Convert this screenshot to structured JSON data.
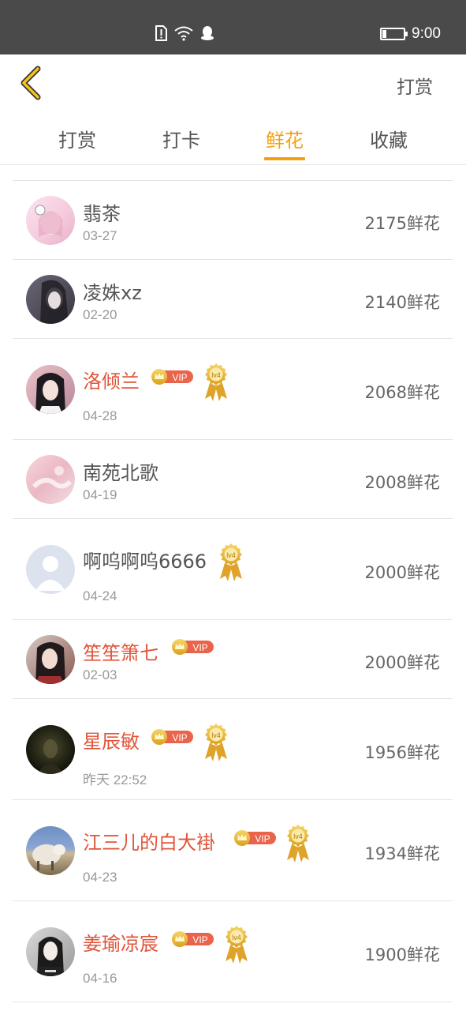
{
  "status_bar": {
    "time": "9:00",
    "icons": [
      "sim-alert-icon",
      "wifi-icon",
      "qq-icon"
    ],
    "battery_icon": "battery-icon"
  },
  "header": {
    "back_icon": "chevron-left-icon",
    "action_label": "打赏",
    "accent": "#f5c518"
  },
  "tabs": [
    {
      "label": "打赏",
      "active": false
    },
    {
      "label": "打卡",
      "active": false
    },
    {
      "label": "鲜花",
      "active": true
    },
    {
      "label": "收藏",
      "active": false
    }
  ],
  "colors": {
    "tab_active": "#f5a10f",
    "vip_name": "#e0553a",
    "plain_name": "#555555"
  },
  "badges": {
    "vip_label": "VIP",
    "level_label": "lv4"
  },
  "list": [
    {
      "name": "翡茶",
      "date": "03-27",
      "amount": "2175鲜花",
      "vip": false,
      "level": false
    },
    {
      "name": "凌姝xz",
      "date": "02-20",
      "amount": "2140鲜花",
      "vip": false,
      "level": false
    },
    {
      "name": "洛倾兰",
      "date": "04-28",
      "amount": "2068鲜花",
      "vip": true,
      "level": true
    },
    {
      "name": "南苑北歌",
      "date": "04-19",
      "amount": "2008鲜花",
      "vip": false,
      "level": false
    },
    {
      "name": "啊呜啊呜6666",
      "date": "04-24",
      "amount": "2000鲜花",
      "vip": false,
      "level": true
    },
    {
      "name": "笙笙箫七",
      "date": "02-03",
      "amount": "2000鲜花",
      "vip": true,
      "level": false
    },
    {
      "name": "星辰敏",
      "date": "昨天 22:52",
      "amount": "1956鲜花",
      "vip": true,
      "level": true
    },
    {
      "name": "江三儿的白大褂",
      "date": "04-23",
      "amount": "1934鲜花",
      "vip": true,
      "level": true
    },
    {
      "name": "姜瑜凉宸",
      "date": "04-16",
      "amount": "1900鲜花",
      "vip": true,
      "level": true
    }
  ]
}
